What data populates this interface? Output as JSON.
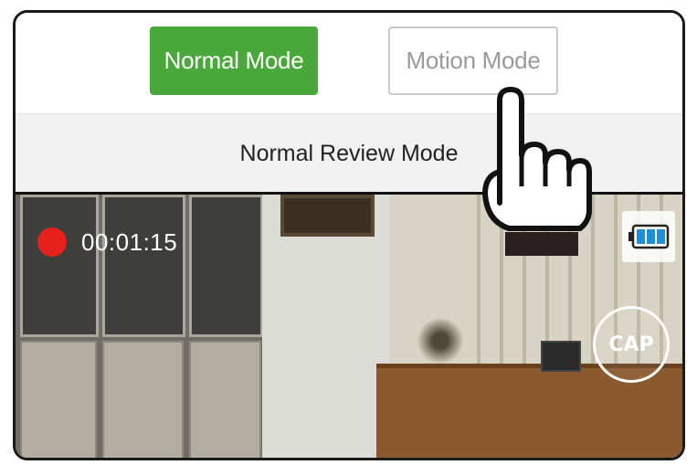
{
  "modes": {
    "normal_label": "Normal Mode",
    "motion_label": "Motion Mode"
  },
  "review": {
    "label": "Normal Review Mode"
  },
  "video": {
    "recording_time": "00:01:15",
    "capture_label": "CAP"
  },
  "colors": {
    "active_mode": "#48a93a",
    "record_dot": "#e8201d",
    "battery": "#1e8fd6"
  },
  "icons": {
    "record": "record-dot-icon",
    "battery": "battery-icon",
    "pointer": "hand-pointer-icon"
  }
}
